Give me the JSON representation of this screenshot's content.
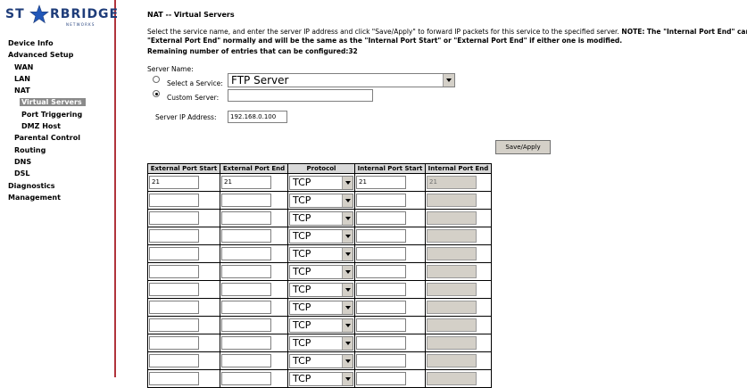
{
  "logo": {
    "text_left": "ST",
    "text_right": "RBRIDGE",
    "sub": "NETWORKS",
    "icon": "star-icon",
    "color": "#1f3d7a"
  },
  "sidebar": {
    "accent_color": "#b0343c",
    "items": [
      {
        "label": "Device Info",
        "level": 0,
        "active": false
      },
      {
        "label": "Advanced Setup",
        "level": 0,
        "active": false
      },
      {
        "label": "WAN",
        "level": 1,
        "active": false
      },
      {
        "label": "LAN",
        "level": 1,
        "active": false
      },
      {
        "label": "NAT",
        "level": 1,
        "active": false
      },
      {
        "label": "Virtual Servers",
        "level": 2,
        "active": true
      },
      {
        "label": "Port Triggering",
        "level": 2,
        "active": false
      },
      {
        "label": "DMZ Host",
        "level": 2,
        "active": false
      },
      {
        "label": "Parental Control",
        "level": 1,
        "active": false
      },
      {
        "label": "Routing",
        "level": 1,
        "active": false
      },
      {
        "label": "DNS",
        "level": 1,
        "active": false
      },
      {
        "label": "DSL",
        "level": 1,
        "active": false
      },
      {
        "label": "Diagnostics",
        "level": 0,
        "active": false
      },
      {
        "label": "Management",
        "level": 0,
        "active": false
      }
    ]
  },
  "page": {
    "title": "NAT -- Virtual Servers",
    "desc_line1_a": "Select the service name, and enter the server IP address and click \"Save/Apply\" to forward IP packets for this service to the specified server.",
    "desc_line1_b": " NOTE: The \"Internal Port End\" cann",
    "desc_line2": "\"External Port End\" normally and will be the same as the \"Internal Port Start\" or \"External Port End\" if either one is modified.",
    "remaining": "Remaining number of entries that can be configured:32"
  },
  "form": {
    "server_name_label": "Server Name:",
    "select_service_label": "Select a Service:",
    "selected_service": "FTP Server",
    "custom_server_label": "Custom Server:",
    "custom_server_value": "",
    "selected_mode": "custom",
    "server_ip_label": "Server IP Address:",
    "server_ip_value": "192.168.0.100",
    "save_label": "Save/Apply"
  },
  "table": {
    "headers": [
      "External Port Start",
      "External Port End",
      "Protocol",
      "Internal Port Start",
      "Internal Port End"
    ],
    "rows": [
      {
        "ext_start": "21",
        "ext_end": "21",
        "protocol": "TCP",
        "int_start": "21",
        "int_end": "21"
      },
      {
        "ext_start": "",
        "ext_end": "",
        "protocol": "TCP",
        "int_start": "",
        "int_end": ""
      },
      {
        "ext_start": "",
        "ext_end": "",
        "protocol": "TCP",
        "int_start": "",
        "int_end": ""
      },
      {
        "ext_start": "",
        "ext_end": "",
        "protocol": "TCP",
        "int_start": "",
        "int_end": ""
      },
      {
        "ext_start": "",
        "ext_end": "",
        "protocol": "TCP",
        "int_start": "",
        "int_end": ""
      },
      {
        "ext_start": "",
        "ext_end": "",
        "protocol": "TCP",
        "int_start": "",
        "int_end": ""
      },
      {
        "ext_start": "",
        "ext_end": "",
        "protocol": "TCP",
        "int_start": "",
        "int_end": ""
      },
      {
        "ext_start": "",
        "ext_end": "",
        "protocol": "TCP",
        "int_start": "",
        "int_end": ""
      },
      {
        "ext_start": "",
        "ext_end": "",
        "protocol": "TCP",
        "int_start": "",
        "int_end": ""
      },
      {
        "ext_start": "",
        "ext_end": "",
        "protocol": "TCP",
        "int_start": "",
        "int_end": ""
      },
      {
        "ext_start": "",
        "ext_end": "",
        "protocol": "TCP",
        "int_start": "",
        "int_end": ""
      },
      {
        "ext_start": "",
        "ext_end": "",
        "protocol": "TCP",
        "int_start": "",
        "int_end": ""
      }
    ]
  }
}
